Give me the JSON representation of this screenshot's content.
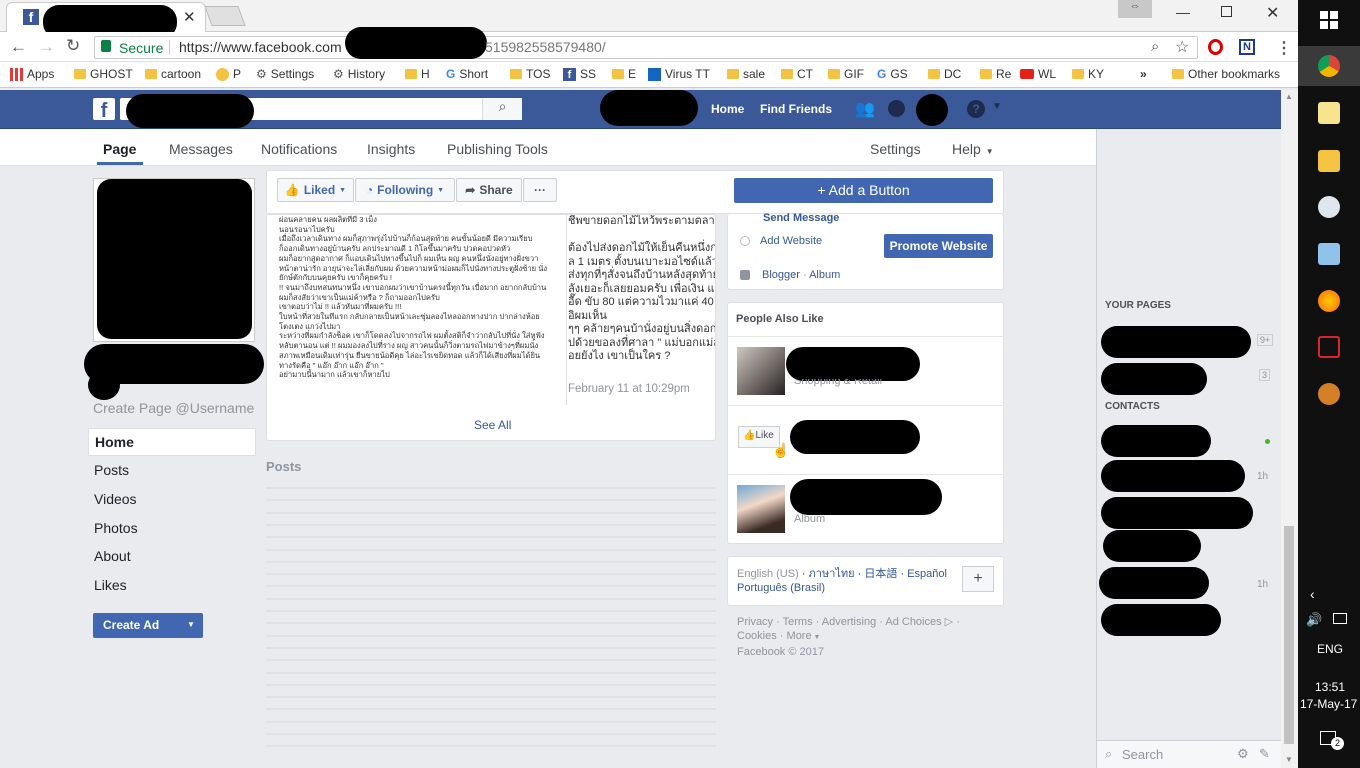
{
  "browser": {
    "tab_title": "",
    "secure_label": "Secure",
    "url_prefix": "https://www.facebook.com",
    "url_suffix": "515982558579480/",
    "bookmarks": [
      {
        "label": "Apps",
        "icon": "apps-grid-icon"
      },
      {
        "label": "GHOST",
        "icon": "folder-icon"
      },
      {
        "label": "cartoon",
        "icon": "folder-icon"
      },
      {
        "label": "P",
        "icon": "smiley-icon"
      },
      {
        "label": "Settings",
        "icon": "gear-icon"
      },
      {
        "label": "History",
        "icon": "gear-icon"
      },
      {
        "label": "H",
        "icon": "folder-icon"
      },
      {
        "label": "Short",
        "icon": "google-icon"
      },
      {
        "label": "TOS",
        "icon": "folder-icon"
      },
      {
        "label": "SS",
        "icon": "facebook-icon"
      },
      {
        "label": "E",
        "icon": "folder-icon"
      },
      {
        "label": "Virus TT",
        "icon": "flag-icon"
      },
      {
        "label": "sale",
        "icon": "folder-icon"
      },
      {
        "label": "CT",
        "icon": "folder-icon"
      },
      {
        "label": "GIF",
        "icon": "folder-icon"
      },
      {
        "label": "GS",
        "icon": "translate-icon"
      },
      {
        "label": "DC",
        "icon": "folder-icon"
      },
      {
        "label": "Re",
        "icon": "folder-icon"
      },
      {
        "label": "WL",
        "icon": "youtube-icon"
      },
      {
        "label": "KY",
        "icon": "folder-icon"
      }
    ],
    "overflow": "»",
    "other_bookmarks": "Other bookmarks"
  },
  "fb_header": {
    "logo": "f",
    "nav": [
      "Home",
      "Find Friends"
    ]
  },
  "page_tabs": {
    "left": [
      "Page",
      "Messages",
      "Notifications",
      "Insights",
      "Publishing Tools"
    ],
    "active": "Page",
    "settings": "Settings",
    "help": "Help"
  },
  "left_col": {
    "create_username": "Create Page @Username",
    "nav": [
      "Home",
      "Posts",
      "Videos",
      "Photos",
      "About",
      "Likes"
    ],
    "active_nav": "Home",
    "create_ad": "Create Ad"
  },
  "actions": {
    "liked": "Liked",
    "following": "Following",
    "share": "Share",
    "more": "···",
    "add_button": "+ Add a Button"
  },
  "feed": {
    "thai_left": [
      "ผ่อนคลายคน ผลผลิตที่มี 3 เม็ง",
      "นอนรอนาไปครับ",
      "เมื่อถึงเวลาเดินทาง ผมก็สุภาพรุ่งไปบ้านก็ก้อนสุดท้าย คนขั้นน้อยดี มีความเรียบ",
      "ก็ออกเดินทางอยู่บ้านครับ ลกประมาณดี 1 กิโลขึ้นมาครับ ปวดคอปวดหัว",
      "ผมก็อยากสูดอากาศ ก็แอบเดินไปทางขึ้นไปก็ ผมเห็น ผญ คนหนึ่งนั่งอยู่ทางฝั่งขวา",
      "หน้าตาน่ารัก อายุน่าจะไล่เลี่ยกับผม ด้วยความหน้าม่อผมก็ไปนั่งทางประตูฝั่งซ้าย นั่ง",
      "ยักษ์ตักกับบนคุยครับ เขาก็คุยครับ !",
      "!! จนมาถึงบทสนทนาหนึ่ง เขาบอกผมว่าเขาบ้านตรงนี้ทุกวัน เบื่อมาก อยากกลับบ้าน",
      "ผมก็สงสัยว่าเขาเป็นแม่ค้าหรือ ? ก็ถามออกไปครับ",
      "เขาตอบว่าไม่ !! แล้วหันมาที่ผมครับ !!!",
      "ใบหน้าที่สวยในทีแรก กลับกลายเป็นหน้าเละซุ่มลองไหลออกทางปาก ปากล่างห้อย",
      "โตงเตง แกว่งไปมา",
      "ระหว่างที่ผมกำลังช็อค เขาก็โดดลงไปจากรถไฟ ผมตั้งสติก็จำว่ากลับไปที่นั่ง ใส่หูฟัง",
      "หลับตานอน แต่ !! ผมมองลงไปที่ราง ผญ สาวคนนั้นก็วิ่งตามรถไฟมาข้างๆที่ผมนั่ง",
      "สภาพเหมือนเดิมเท่ารุ่น ยืนขายน้อดีคุย ไล่อะไรเขยิดทอด แล้วก็ได้เสียงที่ผมได้ยิน",
      "ทางรัดคือ \" แอ๊ก อ๊าก แอ๊ก อ๊าก \"",
      "อย่ามาบนี้นามาก แล้วเขาก็หายไป"
    ],
    "thai_right": [
      "ชีพขายดอกไม้ไหว้พระตามตลาด",
      "",
      "ต้องไปส่งดอกไม้ให้เย็นคืนหนึ่งก่อ",
      "ล 1 เมตร ตั้งบนเบาะมอไซด์แล้วไป",
      "ส่งทุกที่ๆสั่งจนถึงบ้านหลังสุดท้าย",
      "ลังเยอะก็เลยยอมครับ เพื่อเงิน แ",
      "อื๊ด ขับ 80 แต่ความไวมาแค่ 40 แ",
      "อิผมเห็น",
      "ๆๆ คล้ายๆคนบ้านั่งอยู่บนสิ่งดอกไ",
      "ปด้วยขอลงที่ศาลา \" แม่บอกแม่ส",
      "อยยังไง เขาเป็นใคร ?"
    ],
    "timestamp": "February 11 at 10:29pm",
    "see_all": "See All",
    "posts_heading": "Posts"
  },
  "right_col": {
    "send_message": "Send Message",
    "add_website": "Add Website",
    "promote_website": "Promote Website",
    "blogger": "Blogger",
    "album": "Album",
    "people_also_like": "People Also Like",
    "like_label": "Like",
    "suggestion_sub_1": "Shopping & Retail",
    "suggestion_sub_3": "Album",
    "languages": [
      "English (US)",
      "ภาษาไทย",
      "日本語",
      "Español",
      "Português (Brasil)"
    ],
    "footer_links_1": [
      "Privacy",
      "Terms",
      "Advertising",
      "Ad Choices"
    ],
    "footer_links_2": [
      "Cookies",
      "More"
    ],
    "copyright": "Facebook © 2017"
  },
  "chat_sidebar": {
    "your_pages": "YOUR PAGES",
    "badge_1": "9+",
    "badge_2": "3",
    "contacts": "CONTACTS",
    "time_1": "1h",
    "time_2": "1h",
    "search_placeholder": "Search"
  },
  "taskbar": {
    "time": "13:51",
    "date": "17-May-17",
    "lang": "ENG",
    "notif_count": "2"
  },
  "colors": {
    "fb_blue": "#3b5998",
    "button_blue": "#4267b2",
    "link_blue": "#365899"
  }
}
